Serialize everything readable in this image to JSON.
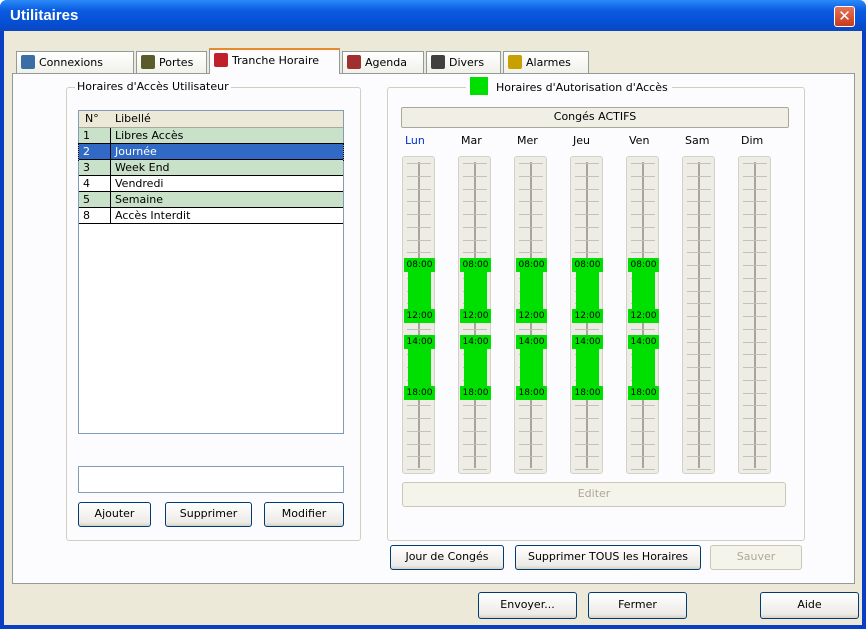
{
  "window": {
    "title": "Utilitaires",
    "close_label": "✕"
  },
  "tabs": [
    {
      "label": "Connexions",
      "icon": "network-icon",
      "color": "#3a6ea5"
    },
    {
      "label": "Portes",
      "icon": "door-icon",
      "color": "#5a5a2a"
    },
    {
      "label": "Tranche Horaire",
      "icon": "timeslot-icon",
      "color": "#c0202a"
    },
    {
      "label": "Agenda",
      "icon": "agenda-icon",
      "color": "#a03030"
    },
    {
      "label": "Divers",
      "icon": "misc-icon",
      "color": "#404040"
    },
    {
      "label": "Alarmes",
      "icon": "speaker-icon",
      "color": "#c8a000"
    }
  ],
  "left": {
    "group_label": "Horaires d'Accès Utilisateur",
    "columns": [
      "N°",
      "Libellé"
    ],
    "rows": [
      {
        "n": "1",
        "label": "Libres Accès",
        "style": "green"
      },
      {
        "n": "2",
        "label": "Journée",
        "style": "selected"
      },
      {
        "n": "3",
        "label": "Week End",
        "style": "green"
      },
      {
        "n": "4",
        "label": "Vendredi",
        "style": "white"
      },
      {
        "n": "5",
        "label": "Semaine",
        "style": "green"
      },
      {
        "n": "8",
        "label": "Accès Interdit",
        "style": "white"
      }
    ],
    "input_value": "",
    "add_label": "Ajouter",
    "delete_label": "Supprimer",
    "edit_label": "Modifier"
  },
  "right": {
    "group_label": "Horaires d'Autorisation d'Accès",
    "legend_color": "#00e000",
    "status": "Congés ACTIFS",
    "days": [
      {
        "name": "Lun",
        "active": true
      },
      {
        "name": "Mar",
        "active": false
      },
      {
        "name": "Mer",
        "active": false
      },
      {
        "name": "Jeu",
        "active": false
      },
      {
        "name": "Ven",
        "active": false
      },
      {
        "name": "Sam",
        "active": false
      },
      {
        "name": "Dim",
        "active": false
      }
    ],
    "slots": [
      {
        "start": "08:00",
        "end": "12:00"
      },
      {
        "start": "14:00",
        "end": "18:00"
      }
    ],
    "slot_days": [
      "Lun",
      "Mar",
      "Mer",
      "Jeu",
      "Ven"
    ],
    "edit_label": "Editer"
  },
  "actions": {
    "holiday_label": "Jour de Congés",
    "delete_all_label": "Supprimer TOUS les Horaires",
    "save_label": "Sauver"
  },
  "footer": {
    "send_label": "Envoyer...",
    "close_label": "Fermer",
    "help_label": "Aide"
  }
}
